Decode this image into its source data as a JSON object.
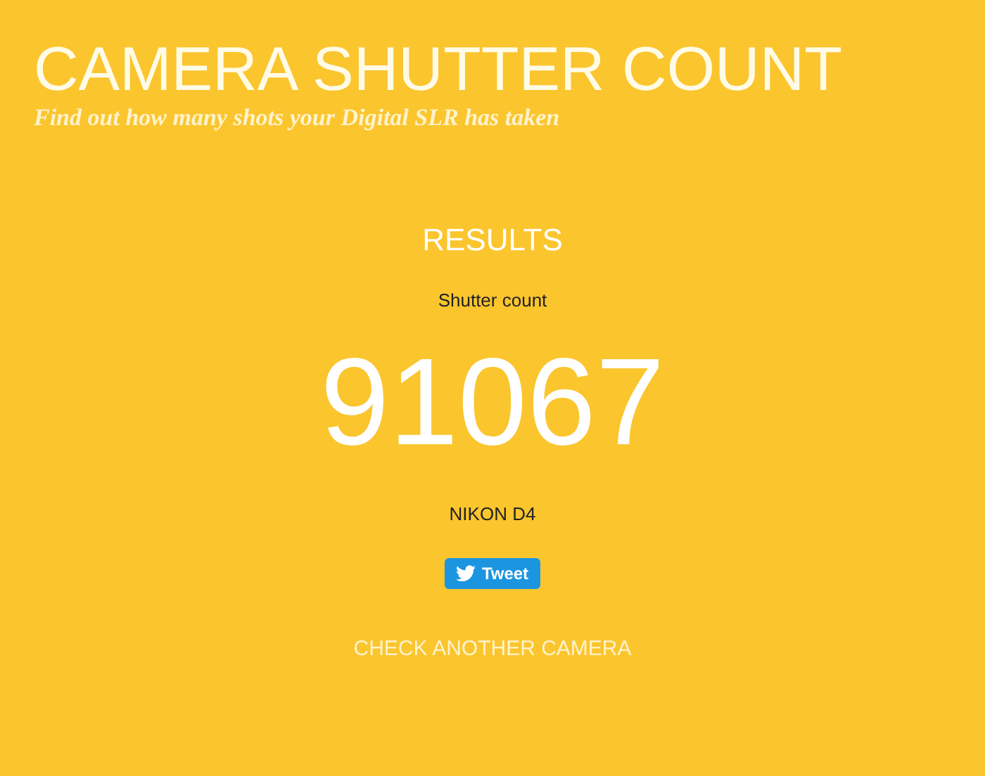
{
  "header": {
    "title": "CAMERA SHUTTER COUNT",
    "tagline": "Find out how many shots your Digital SLR has taken"
  },
  "results": {
    "heading": "RESULTS",
    "label": "Shutter count",
    "count": "91067",
    "camera": "NIKON D4"
  },
  "tweet_button": {
    "label": "Tweet"
  },
  "link": "CHECK ANOTHER CAMERA"
}
